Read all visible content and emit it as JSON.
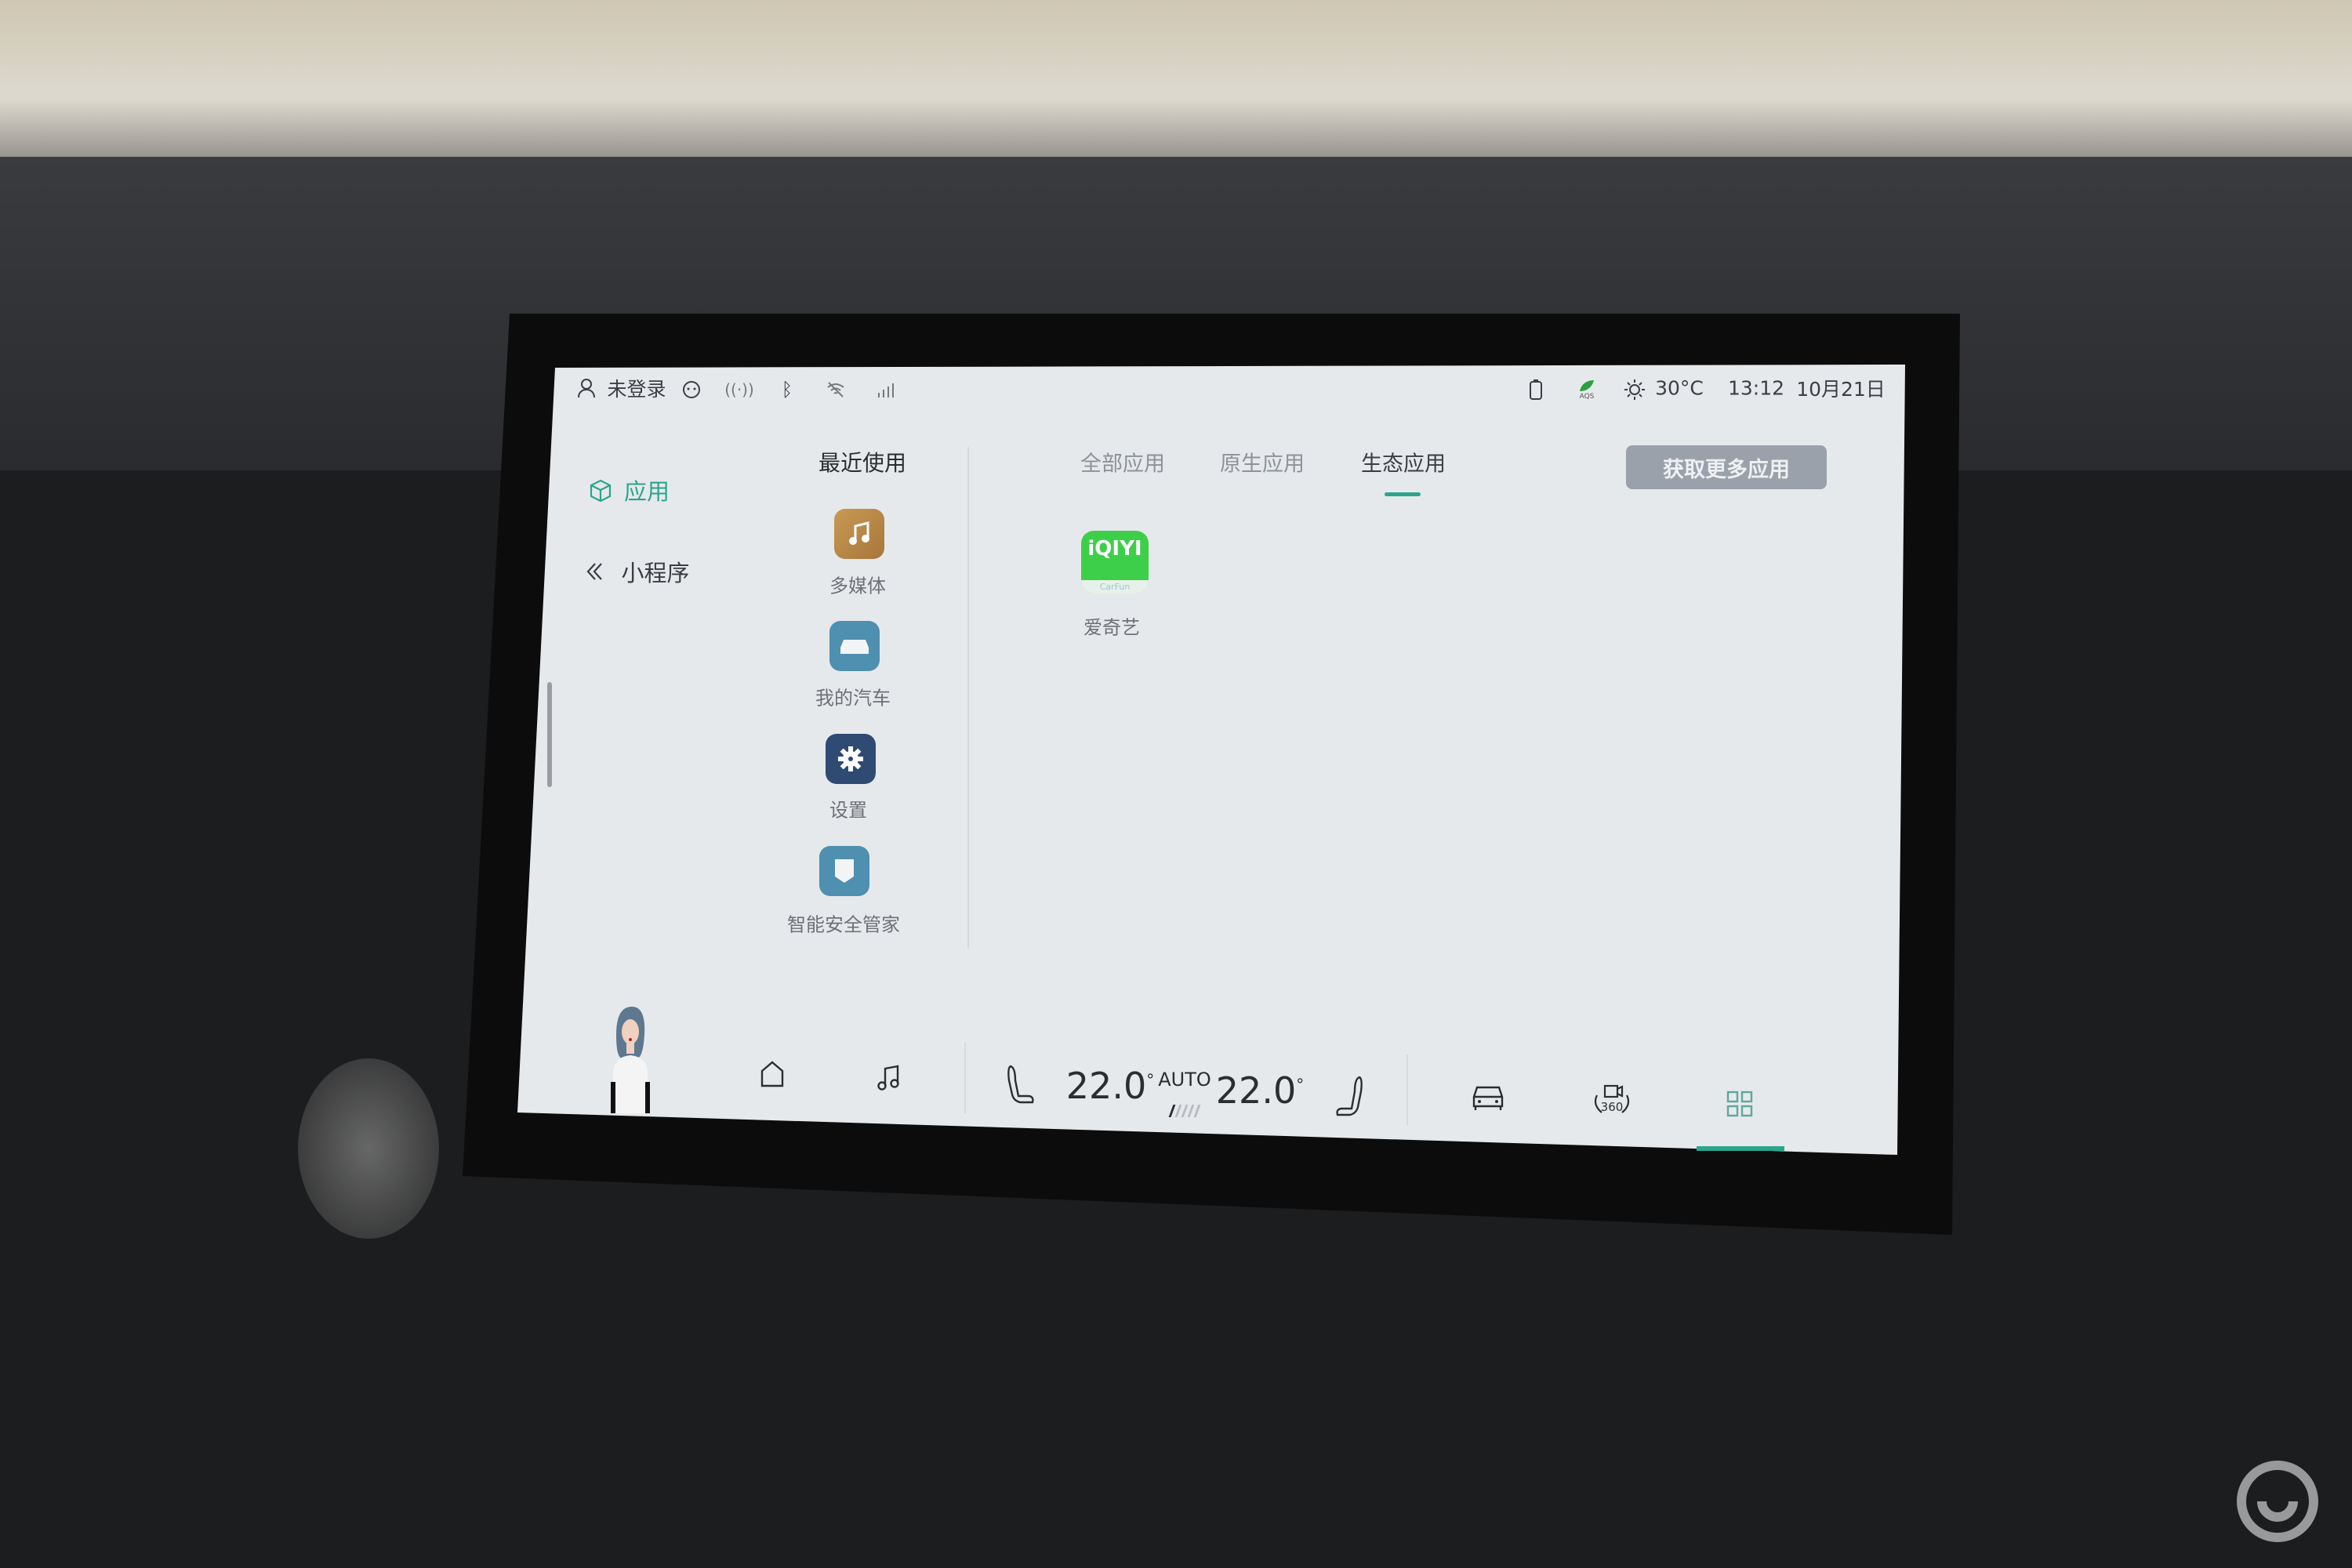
{
  "status_bar": {
    "user": "未登录",
    "temperature": "30°C",
    "aqs_label": "AQS",
    "time": "13:12",
    "date": "10月21日",
    "icons": [
      "user-icon",
      "message-icon",
      "hotspot-icon",
      "bluetooth-icon",
      "wifi-off-icon",
      "signal-5g-icon",
      "phone-icon",
      "aqs-leaf-icon",
      "sun-icon"
    ]
  },
  "sidebar": {
    "items": [
      {
        "label": "应用",
        "icon": "cube-icon",
        "active": true
      },
      {
        "label": "小程序",
        "icon": "mini-program-icon",
        "active": false
      }
    ]
  },
  "recent": {
    "title": "最近使用",
    "apps": [
      {
        "label": "多媒体",
        "icon": "music-note-icon",
        "color": "#b98a4a"
      },
      {
        "label": "我的汽车",
        "icon": "car-icon",
        "color": "#4f8fb0"
      },
      {
        "label": "设置",
        "icon": "gear-icon",
        "color": "#2f4a73"
      },
      {
        "label": "智能安全管家",
        "icon": "shield-icon",
        "color": "#4f8fb0"
      }
    ]
  },
  "tabs": [
    {
      "label": "全部应用",
      "active": false
    },
    {
      "label": "原生应用",
      "active": false
    },
    {
      "label": "生态应用",
      "active": true
    }
  ],
  "get_more_button": "获取更多应用",
  "ecosystem_apps": [
    {
      "label": "爱奇艺",
      "logo_text": "iQIYI",
      "logo_sub": "CarFun",
      "color": "#3ecf4a"
    }
  ],
  "dock": {
    "left_temp": "22.0",
    "right_temp": "22.0",
    "degree": "°",
    "climate_mode": "AUTO",
    "fan_level": 1,
    "fan_max": 5,
    "badge_360": "360",
    "icons": [
      "assistant-avatar",
      "home-icon",
      "music-icon",
      "driver-seat-icon",
      "passenger-seat-icon",
      "car-icon",
      "camera-360-icon",
      "app-grid-icon"
    ],
    "active": "app-grid-icon"
  },
  "colors": {
    "accent": "#2aa58c",
    "screen_bg": "#e6e9ec",
    "button_bg": "#9aa1aa"
  },
  "watermark": "易车"
}
